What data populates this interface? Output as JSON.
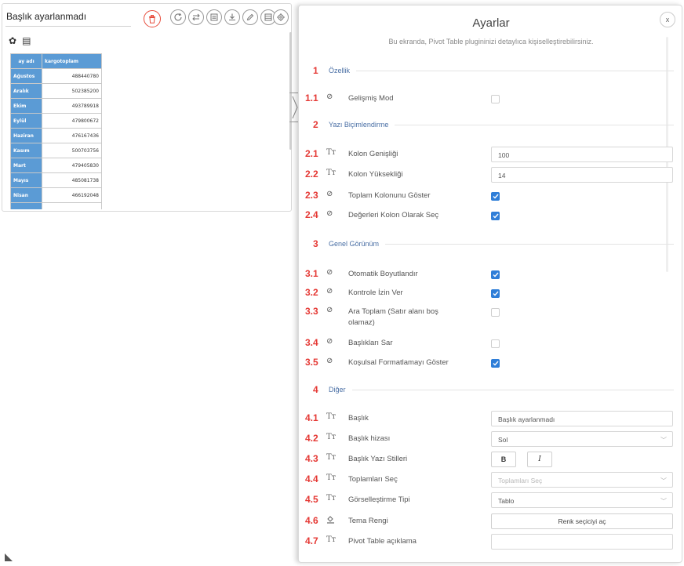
{
  "widget": {
    "title": "Başlık ayarlanmadı",
    "toolbar_icons": [
      "trash-icon",
      "refresh-icon",
      "swap-icon",
      "list-icon",
      "download-icon",
      "edit-icon",
      "table-icon",
      "gear-icon"
    ],
    "table": {
      "headers": [
        "ay adı",
        "kargotoplam"
      ],
      "rows": [
        {
          "label": "Ağustos",
          "value": "488440780"
        },
        {
          "label": "Aralık",
          "value": "502385200"
        },
        {
          "label": "Ekim",
          "value": "493789918"
        },
        {
          "label": "Eylül",
          "value": "479800672"
        },
        {
          "label": "Haziran",
          "value": "476167436"
        },
        {
          "label": "Kasım",
          "value": "500703756"
        },
        {
          "label": "Mart",
          "value": "479405830"
        },
        {
          "label": "Mayıs",
          "value": "485081738"
        },
        {
          "label": "Nisan",
          "value": "466192048"
        }
      ]
    }
  },
  "panel": {
    "title": "Ayarlar",
    "subtitle": "Bu ekranda, Pivot Table plugininizi detaylıca kişiselleştirebilirsiniz.",
    "close_label": "x",
    "sections": [
      {
        "num": "1",
        "title": "Özellik"
      },
      {
        "num": "2",
        "title": "Yazı Biçimlendirme"
      },
      {
        "num": "3",
        "title": "Genel Görünüm"
      },
      {
        "num": "4",
        "title": "Diğer"
      }
    ],
    "rows": {
      "r1_1": {
        "num": "1.1",
        "icon": "⊘",
        "label": "Gelişmiş Mod",
        "checked": false
      },
      "r2_1": {
        "num": "2.1",
        "icon": "Tт",
        "label": "Kolon Genişliği",
        "value": "100"
      },
      "r2_2": {
        "num": "2.2",
        "icon": "Tт",
        "label": "Kolon Yüksekliği",
        "value": "14"
      },
      "r2_3": {
        "num": "2.3",
        "icon": "⊘",
        "label": "Toplam Kolonunu Göster",
        "checked": true
      },
      "r2_4": {
        "num": "2.4",
        "icon": "⊘",
        "label": "Değerleri Kolon Olarak Seç",
        "checked": true
      },
      "r3_1": {
        "num": "3.1",
        "icon": "⊘",
        "label": "Otomatik Boyutlandır",
        "checked": true
      },
      "r3_2": {
        "num": "3.2",
        "icon": "⊘",
        "label": "Kontrole İzin Ver",
        "checked": true
      },
      "r3_3": {
        "num": "3.3",
        "icon": "⊘",
        "label": "Ara Toplam (Satır alanı boş olamaz)",
        "checked": false
      },
      "r3_4": {
        "num": "3.4",
        "icon": "⊘",
        "label": "Başlıkları Sar",
        "checked": false
      },
      "r3_5": {
        "num": "3.5",
        "icon": "⊘",
        "label": "Koşulsal Formatlamayı Göster",
        "checked": true
      },
      "r4_1": {
        "num": "4.1",
        "icon": "Tт",
        "label": "Başlık",
        "value": "Başlık ayarlanmadı"
      },
      "r4_2": {
        "num": "4.2",
        "icon": "Tт",
        "label": "Başlık hizası",
        "value": "Sol"
      },
      "r4_3": {
        "num": "4.3",
        "icon": "Tт",
        "label": "Başlık Yazı Stilleri",
        "bold_label": "B",
        "italic_label": "I"
      },
      "r4_4": {
        "num": "4.4",
        "icon": "Tт",
        "label": "Toplamları Seç",
        "placeholder": "Toplamları Seç"
      },
      "r4_5": {
        "num": "4.5",
        "icon": "Tт",
        "label": "Görselleştirme Tipi",
        "value": "Tablo"
      },
      "r4_6": {
        "num": "4.6",
        "icon": "paint-bucket-icon",
        "label": "Tema Rengi",
        "button_label": "Renk seçiciyi aç"
      },
      "r4_7": {
        "num": "4.7",
        "icon": "Tт",
        "label": "Pivot Table açıklama",
        "value": ""
      }
    }
  },
  "colors": {
    "accent_red": "#e53935",
    "header_blue": "#5b9bd5",
    "checkbox_blue": "#2f7ed8",
    "section_title": "#4a6fa5"
  }
}
